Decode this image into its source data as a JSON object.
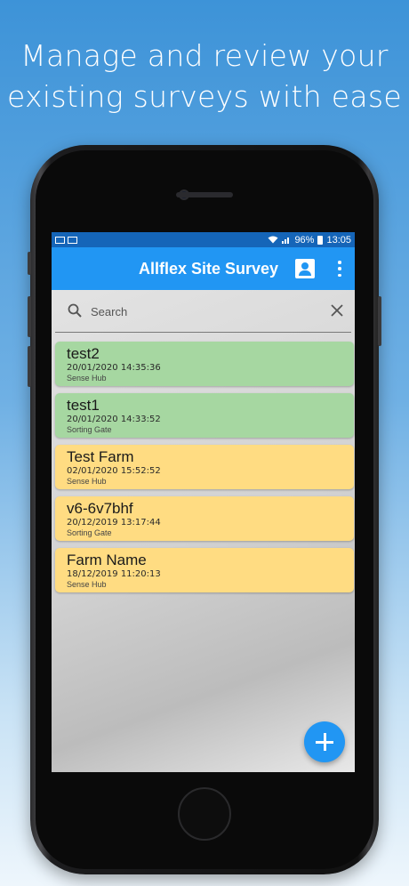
{
  "headline": {
    "line1": "Manage and review your",
    "line2": "existing surveys with ease"
  },
  "status_bar": {
    "battery": "96%",
    "time": "13:05"
  },
  "app_bar": {
    "title": "Allflex Site Survey",
    "profile_icon": "account-box-icon",
    "menu_icon": "more-vert-icon"
  },
  "search": {
    "placeholder": "Search",
    "value": ""
  },
  "colors": {
    "app_bar": "#2196f3",
    "status_bar": "#1565b8",
    "card_green": "#a6d7a1",
    "card_yellow": "#ffdc82",
    "fab": "#2196f3"
  },
  "surveys": [
    {
      "name": "test2",
      "date": "20/01/2020 14:35:36",
      "type": "Sense Hub",
      "status": "green"
    },
    {
      "name": "test1",
      "date": "20/01/2020 14:33:52",
      "type": "Sorting Gate",
      "status": "green"
    },
    {
      "name": "Test Farm",
      "date": "02/01/2020 15:52:52",
      "type": "Sense Hub",
      "status": "yellow"
    },
    {
      "name": "v6-6v7bhf",
      "date": "20/12/2019 13:17:44",
      "type": "Sorting Gate",
      "status": "yellow"
    },
    {
      "name": "Farm Name",
      "date": "18/12/2019 11:20:13",
      "type": "Sense Hub",
      "status": "yellow"
    }
  ],
  "fab": {
    "icon": "add-icon"
  }
}
